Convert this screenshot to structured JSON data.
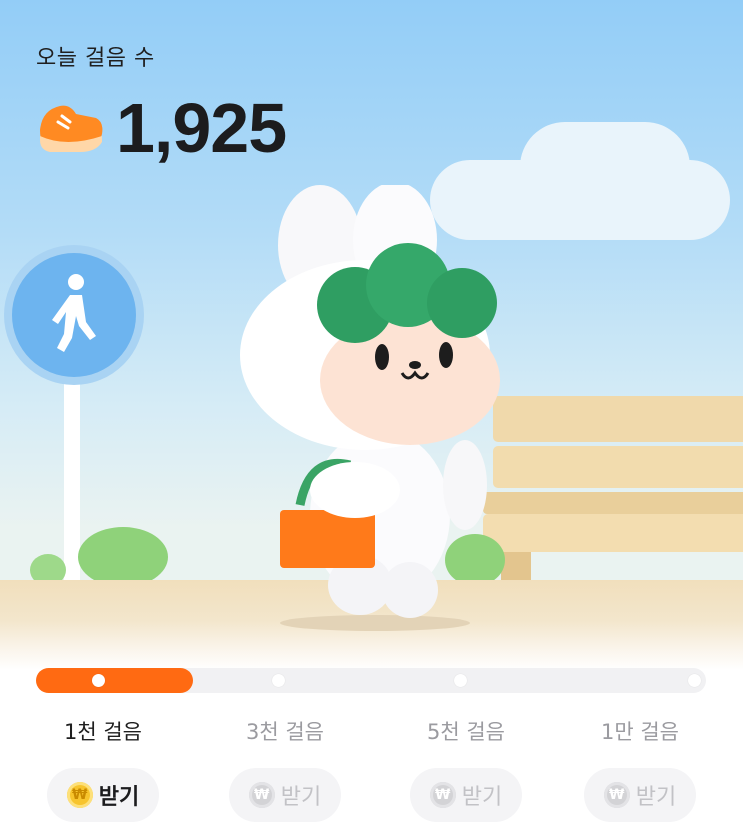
{
  "header": {
    "title": "오늘 걸음 수",
    "step_count": "1,925"
  },
  "progress": {
    "fraction": 0.235,
    "color": "#ff6a12"
  },
  "milestones": [
    {
      "label": "1천 걸음",
      "claim_label": "받기",
      "active": true,
      "coin_icon": "won-coin-icon",
      "coin_glyph": "₩"
    },
    {
      "label": "3천 걸음",
      "claim_label": "받기",
      "active": false,
      "coin_icon": "won-coin-icon",
      "coin_glyph": "₩"
    },
    {
      "label": "5천 걸음",
      "claim_label": "받기",
      "active": false,
      "coin_icon": "won-coin-icon",
      "coin_glyph": "₩"
    },
    {
      "label": "1만 걸음",
      "claim_label": "받기",
      "active": false,
      "coin_icon": "won-coin-icon",
      "coin_glyph": "₩"
    }
  ],
  "colors": {
    "accent": "#ff6a12",
    "sky": "#93cdf7",
    "character_hair": "#3da06a"
  }
}
